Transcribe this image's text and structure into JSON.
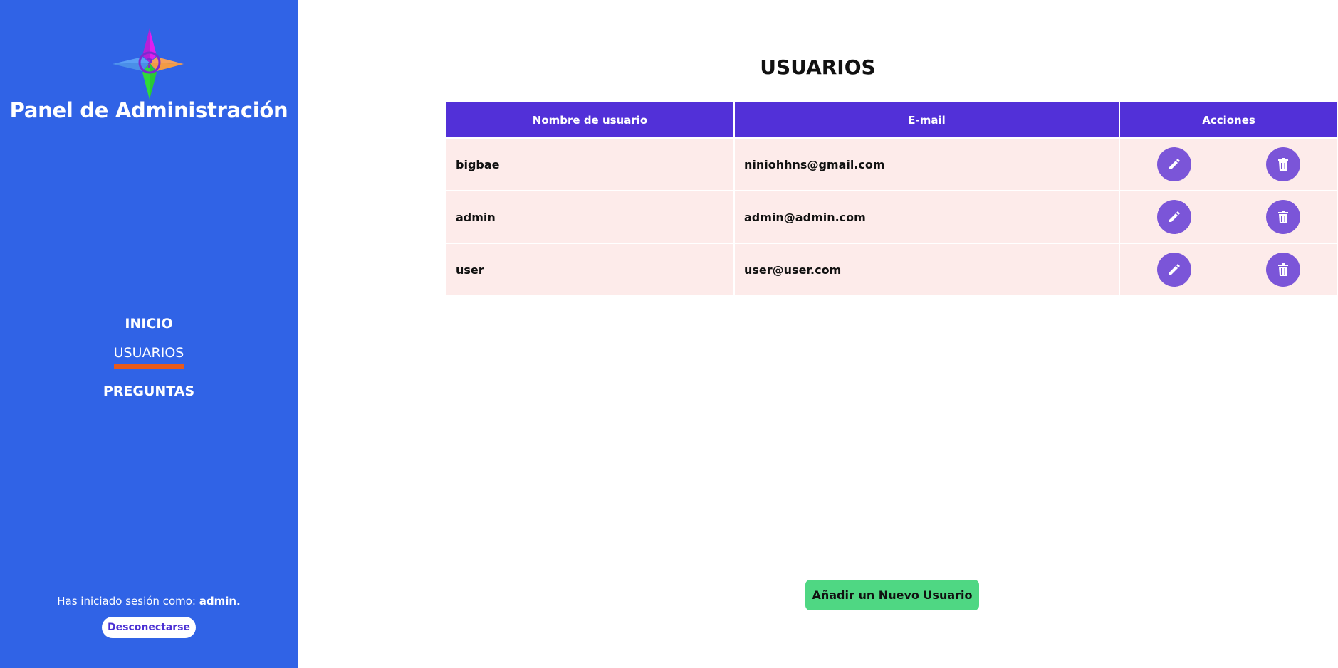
{
  "sidebar": {
    "title": "Panel de Administración",
    "logo_icon": "compass-question-logo",
    "nav": [
      {
        "label": "INICIO"
      },
      {
        "label": "USUARIOS",
        "active": true
      },
      {
        "label": "PREGUNTAS"
      }
    ],
    "session_prefix": "Has iniciado sesión como: ",
    "session_user": "admin.",
    "logout_label": "Desconectarse",
    "background_color": "#3063e6",
    "active_underline_color": "#e85a1a"
  },
  "main": {
    "title": "USUARIOS",
    "table": {
      "columns": [
        "Nombre de usuario",
        "E-mail",
        "Acciones"
      ],
      "rows": [
        {
          "username": "bigbae",
          "email": "niniohhns@gmail.com"
        },
        {
          "username": "admin",
          "email": "admin@admin.com"
        },
        {
          "username": "user",
          "email": "user@user.com"
        }
      ],
      "header_color": "#5230d8",
      "row_color": "#fdebea",
      "edit_icon": "pencil-icon",
      "delete_icon": "trash-icon"
    },
    "add_button_label": "Añadir un Nuevo Usuario",
    "add_button_color": "#4fd783"
  }
}
